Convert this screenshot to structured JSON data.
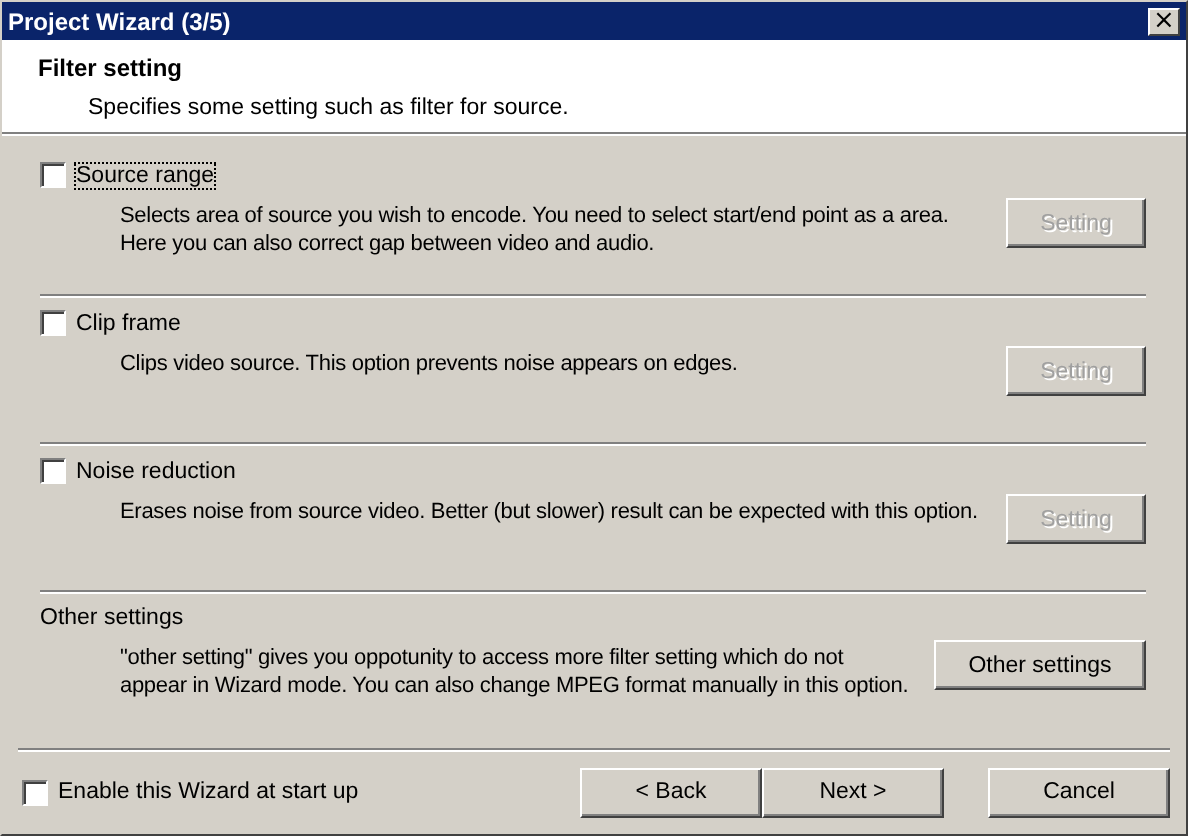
{
  "window": {
    "title": "Project Wizard (3/5)",
    "close": "×"
  },
  "header": {
    "title": "Filter setting",
    "subtitle": "Specifies some setting such as filter for source."
  },
  "options": [
    {
      "kind": "checkbox",
      "label": "Source range",
      "checked": false,
      "focused": true,
      "description": "Selects area of source you wish to encode. You need to select start/end point as a area.\nHere you can also correct gap between video and audio.",
      "button": {
        "label": "Setting",
        "disabled": true
      }
    },
    {
      "kind": "checkbox",
      "label": "Clip frame",
      "checked": false,
      "focused": false,
      "description": "Clips video source. This option prevents noise appears on edges.",
      "button": {
        "label": "Setting",
        "disabled": true
      }
    },
    {
      "kind": "checkbox",
      "label": "Noise reduction",
      "checked": false,
      "focused": false,
      "description": "Erases noise from source video. Better (but slower) result can be expected with this option.",
      "button": {
        "label": "Setting",
        "disabled": true
      }
    },
    {
      "kind": "heading",
      "label": "Other settings",
      "description": "\"other setting\" gives you oppotunity to access more filter setting which do not\nappear in Wizard mode. You can also change MPEG format manually in this option.",
      "button": {
        "label": "Other settings",
        "disabled": false
      }
    }
  ],
  "footer": {
    "startup_checkbox": {
      "label": "Enable this Wizard at start up",
      "checked": false
    },
    "buttons": [
      "< Back",
      "Next >",
      "Cancel"
    ]
  }
}
